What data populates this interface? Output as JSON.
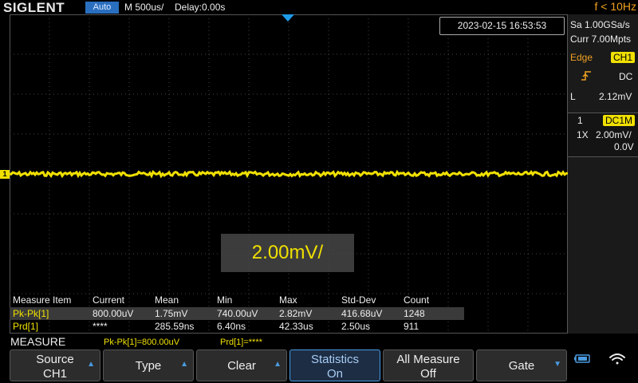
{
  "topbar": {
    "logo": "SIGLENT",
    "mode": "Auto",
    "timebase": "M 500us/",
    "delay": "Delay:0.00s",
    "trigger_freq": "f < 10Hz"
  },
  "datetime": "2023-02-15 16:53:53",
  "acquisition": {
    "sample_rate": "Sa 1.00GSa/s",
    "memory": "Curr 7.00Mpts"
  },
  "trigger": {
    "type": "Edge",
    "source": "CH1",
    "coupling": "DC",
    "level_prefix": "L",
    "level": "2.12mV"
  },
  "channel1": {
    "number": "1",
    "coupling": "DC1M",
    "probe": "1X",
    "scale": "2.00mV/",
    "offset": "0.0V",
    "marker": "1"
  },
  "scale_popup": "2.00mV/",
  "measure_table": {
    "headers": [
      "Measure Item",
      "Current",
      "Mean",
      "Min",
      "Max",
      "Std-Dev",
      "Count"
    ],
    "rows": [
      [
        "Pk-Pk[1]",
        "800.00uV",
        "1.75mV",
        "740.00uV",
        "2.82mV",
        "416.68uV",
        "1248"
      ],
      [
        "Prd[1]",
        "****",
        "285.59ns",
        "6.40ns",
        "42.33us",
        "2.50us",
        "911"
      ]
    ]
  },
  "measure_bar": {
    "title": "MEASURE",
    "pk_pk": "Pk-Pk[1]=800.00uV",
    "prd": "Prd[1]=****"
  },
  "softkeys": {
    "source_l1": "Source",
    "source_l2": "CH1",
    "type": "Type",
    "clear": "Clear",
    "stats_l1": "Statistics",
    "stats_l2": "On",
    "allm_l1": "All Measure",
    "allm_l2": "Off",
    "gate": "Gate"
  },
  "colors": {
    "ch1": "#f0e000",
    "accent": "#4a9be0",
    "trigger": "#f0a020"
  },
  "icons": [
    "trigger-position-icon",
    "rising-edge-icon",
    "battery-icon",
    "wifi-icon"
  ]
}
